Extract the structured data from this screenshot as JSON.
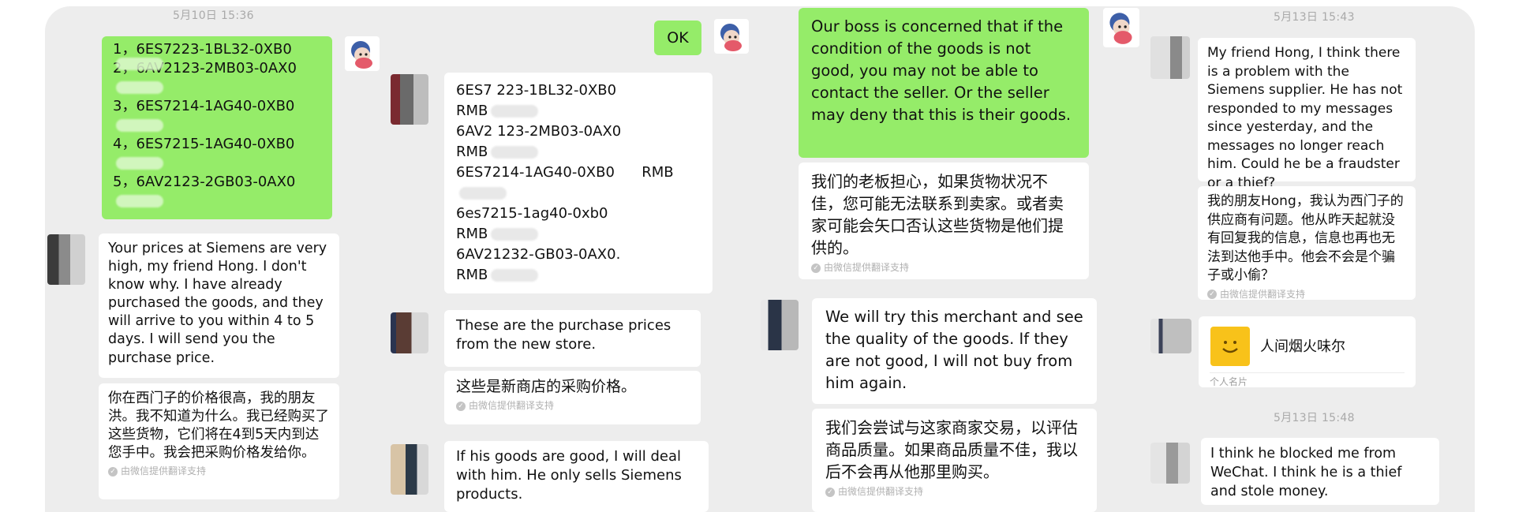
{
  "timestamps": {
    "t1": "5月10日 15:36",
    "t2": "5月13日 15:43",
    "t3": "5月13日 15:48"
  },
  "messages": {
    "m1_lines": [
      "1，6ES7223-1BL32-0XB0",
      "2，6AV2123-2MB03-0AX0",
      "3，6ES7214-1AG40-0XB0",
      "4，6ES7215-1AG40-0XB0",
      "5，6AV2123-2GB03-0AX0"
    ],
    "m2_en": "Your prices at Siemens are very high, my friend Hong. I don't know why. I have already purchased the goods, and they will arrive to you within 4 to 5 days. I will send you the purchase price.",
    "m2_cn": "你在西门子的价格很高，我的朋友洪。我不知道为什么。我已经购买了这些货物，它们将在4到5天内到达您手中。我会把采购价格发给你。",
    "m3_ok": "OK",
    "m4_lines": [
      "6ES7 223-1BL32-0XB0",
      "RMB",
      "6AV2 123-2MB03-0AX0",
      "RMB",
      "6ES7214-1AG40-0XB0      RMB",
      "6es7215-1ag40-0xb0",
      "RMB",
      "6AV21232-GB03-0AX0.",
      "RMB"
    ],
    "m5_en": "These are the purchase prices from the new store.",
    "m5_cn": "这些是新商店的采购价格。",
    "m6_en": "If his goods are good, I will deal with him. He only sells Siemens products.",
    "m7_en": "Our boss is concerned that if the condition of the goods is not good, you may not be able to contact the seller. Or the seller may deny that this is their goods.",
    "m7_cn": "我们的老板担心，如果货物状况不佳，您可能无法联系到卖家。或者卖家可能会矢口否认这些货物是他们提供的。",
    "m8_en": "We will try this merchant and see the quality of the goods. If they are not good, I will not buy from him again.",
    "m8_cn": "我们会尝试与这家商家交易，以评估商品质量。如果商品质量不佳，我以后不会再从他那里购买。",
    "m9_en": "My friend Hong, I think there is a problem with the Siemens supplier. He has not responded to my messages since yesterday, and the messages no longer reach him. Could he be a fraudster or a thief?",
    "m9_cn": "我的朋友Hong，我认为西门子的供应商有问题。他从昨天起就没有回复我的信息，信息也再也无法到达他手中。他会不会是个骗子或小偷？",
    "m10_en": "I think he blocked me from WeChat. I think he is a thief and stole money."
  },
  "translation_note": "由微信提供翻译支持",
  "contact_card": {
    "name": "人间烟火味尔",
    "label": "个人名片"
  },
  "colors": {
    "sent_bubble": "#95ec69",
    "received_bubble": "#ffffff",
    "background": "#ededed",
    "card_logo": "#f8c21a"
  }
}
